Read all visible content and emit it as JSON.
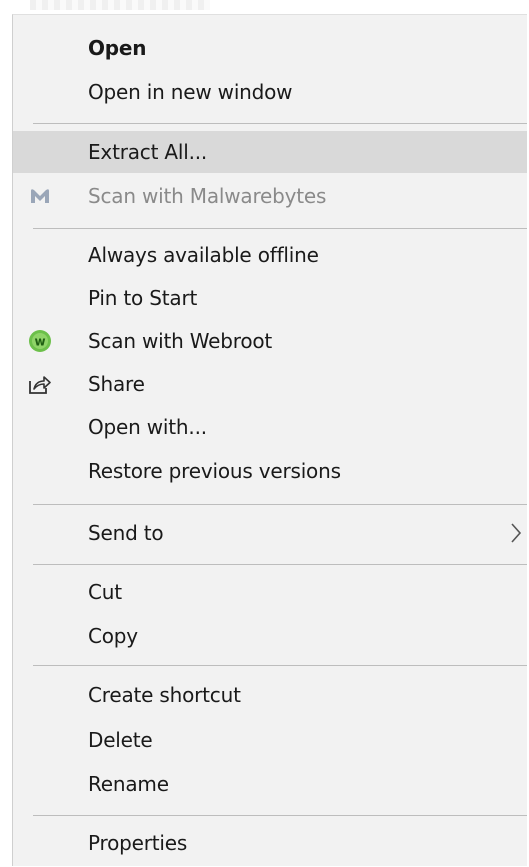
{
  "menu": {
    "open": "Open",
    "open_new_window": "Open in new window",
    "extract_all": "Extract All...",
    "scan_malwarebytes": "Scan with Malwarebytes",
    "always_offline": "Always available offline",
    "pin_to_start": "Pin to Start",
    "scan_webroot": "Scan with Webroot",
    "share": "Share",
    "open_with": "Open with...",
    "restore_versions": "Restore previous versions",
    "send_to": "Send to",
    "cut": "Cut",
    "copy": "Copy",
    "create_shortcut": "Create shortcut",
    "delete": "Delete",
    "rename": "Rename",
    "properties": "Properties"
  },
  "icons": {
    "malwarebytes": "malwarebytes-icon",
    "webroot": "webroot-icon",
    "share": "share-icon",
    "submenu": "chevron-right-icon"
  },
  "colors": {
    "menu_bg": "#f2f2f2",
    "highlight": "#d9d9d9",
    "text": "#1a1a1a",
    "disabled_text": "#8a8a8a",
    "webroot_green": "#6cc04a"
  }
}
